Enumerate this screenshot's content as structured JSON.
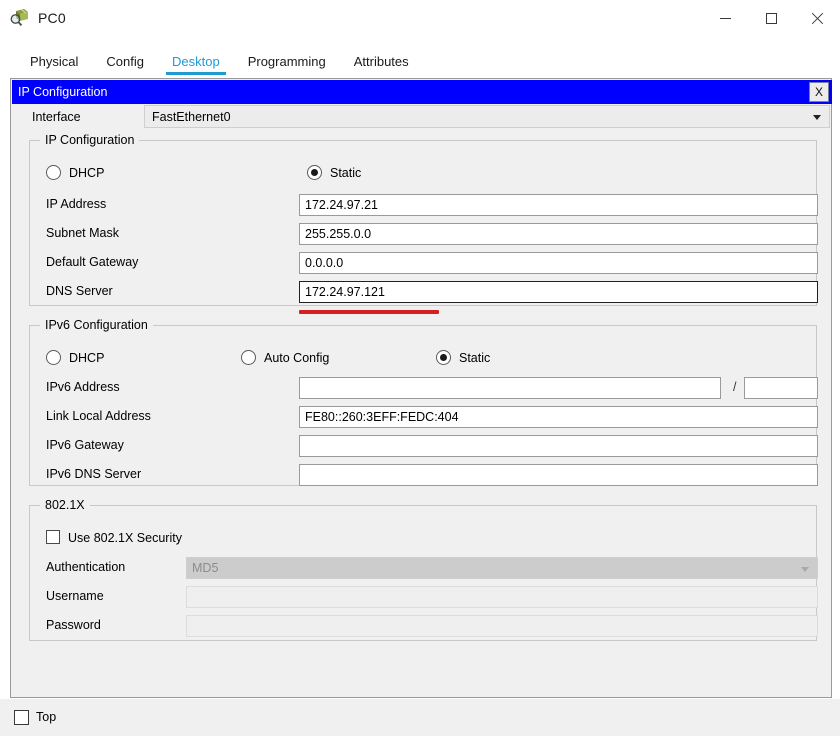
{
  "window": {
    "title": "PC0",
    "icon": "device-pc-icon",
    "buttons": {
      "minimize": "minimize-icon",
      "maximize": "maximize-icon",
      "close": "close-icon"
    }
  },
  "tabs": [
    {
      "label": "Physical",
      "active": false
    },
    {
      "label": "Config",
      "active": false
    },
    {
      "label": "Desktop",
      "active": true
    },
    {
      "label": "Programming",
      "active": false
    },
    {
      "label": "Attributes",
      "active": false
    }
  ],
  "dialog": {
    "title": "IP Configuration",
    "close_label": "X",
    "interface": {
      "label": "Interface",
      "value": "FastEthernet0"
    }
  },
  "ipv4": {
    "legend": "IP Configuration",
    "dhcp_label": "DHCP",
    "static_label": "Static",
    "mode": "static",
    "fields": [
      {
        "label": "IP Address",
        "value": "172.24.97.21"
      },
      {
        "label": "Subnet Mask",
        "value": "255.255.0.0"
      },
      {
        "label": "Default Gateway",
        "value": "0.0.0.0"
      },
      {
        "label": "DNS Server",
        "value": "172.24.97.121"
      }
    ]
  },
  "ipv6": {
    "legend": "IPv6 Configuration",
    "dhcp_label": "DHCP",
    "auto_label": "Auto Config",
    "static_label": "Static",
    "mode": "static",
    "address_label": "IPv6 Address",
    "address_value": "",
    "prefix_separator": "/",
    "prefix_value": "",
    "fields": [
      {
        "label": "Link Local Address",
        "value": "FE80::260:3EFF:FEDC:404"
      },
      {
        "label": "IPv6 Gateway",
        "value": ""
      },
      {
        "label": "IPv6 DNS Server",
        "value": ""
      }
    ]
  },
  "dot1x": {
    "legend": "802.1X",
    "use_security_label": "Use 802.1X Security",
    "use_security_checked": false,
    "auth_label": "Authentication",
    "auth_value": "MD5",
    "username_label": "Username",
    "username_value": "",
    "password_label": "Password",
    "password_value": ""
  },
  "footer": {
    "top_label": "Top",
    "top_checked": false
  },
  "colors": {
    "accent_tab": "#1f9ad2",
    "dialog_titlebar": "#0000ff",
    "annotation": "#d62020",
    "panel_bg": "#f0f0f0"
  }
}
